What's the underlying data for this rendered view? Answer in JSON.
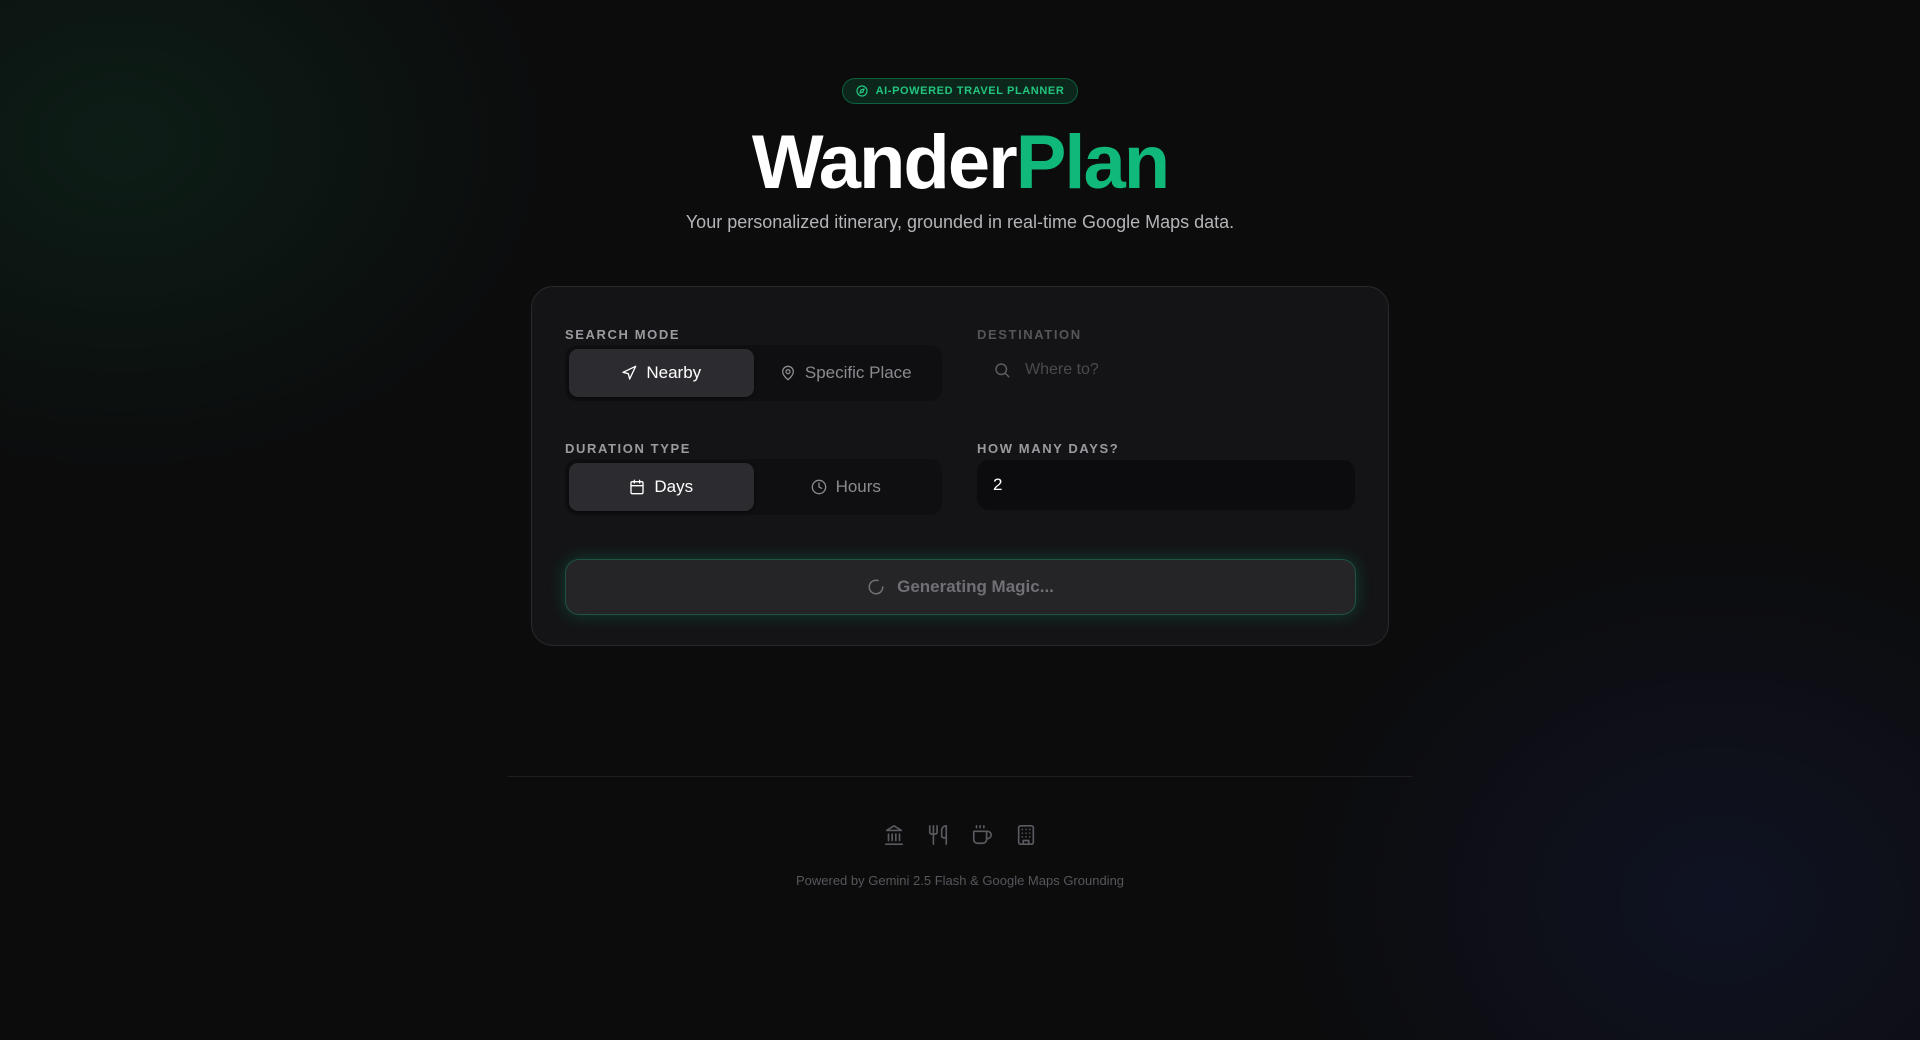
{
  "colors": {
    "accent": "#10b97a",
    "badge_text": "#22c57f",
    "background": "#0c0c0d",
    "card": "#161618"
  },
  "header": {
    "badge": {
      "icon": "compass-icon",
      "label": "AI-POWERED TRAVEL PLANNER"
    },
    "title_part1": "Wander",
    "title_part2": "Plan",
    "subtitle": "Your personalized itinerary, grounded in real-time Google Maps data."
  },
  "form": {
    "search_mode": {
      "label": "SEARCH MODE",
      "options": [
        {
          "label": "Nearby",
          "icon": "navigation-arrow-icon",
          "active": true
        },
        {
          "label": "Specific Place",
          "icon": "map-pin-icon",
          "active": false
        }
      ]
    },
    "destination": {
      "label": "DESTINATION",
      "icon": "search-icon",
      "placeholder": "Where to?",
      "value": ""
    },
    "duration_type": {
      "label": "DURATION TYPE",
      "options": [
        {
          "label": "Days",
          "icon": "calendar-icon",
          "active": true
        },
        {
          "label": "Hours",
          "icon": "clock-icon",
          "active": false
        }
      ]
    },
    "days": {
      "label": "HOW MANY DAYS?",
      "value": "2"
    },
    "submit": {
      "label": "Generating Magic...",
      "icon": "spinner-icon",
      "state": "loading"
    }
  },
  "footer": {
    "icons": [
      "landmark-icon",
      "utensils-icon",
      "coffee-icon",
      "hotel-icon"
    ],
    "text": "Powered by Gemini 2.5 Flash & Google Maps Grounding"
  }
}
